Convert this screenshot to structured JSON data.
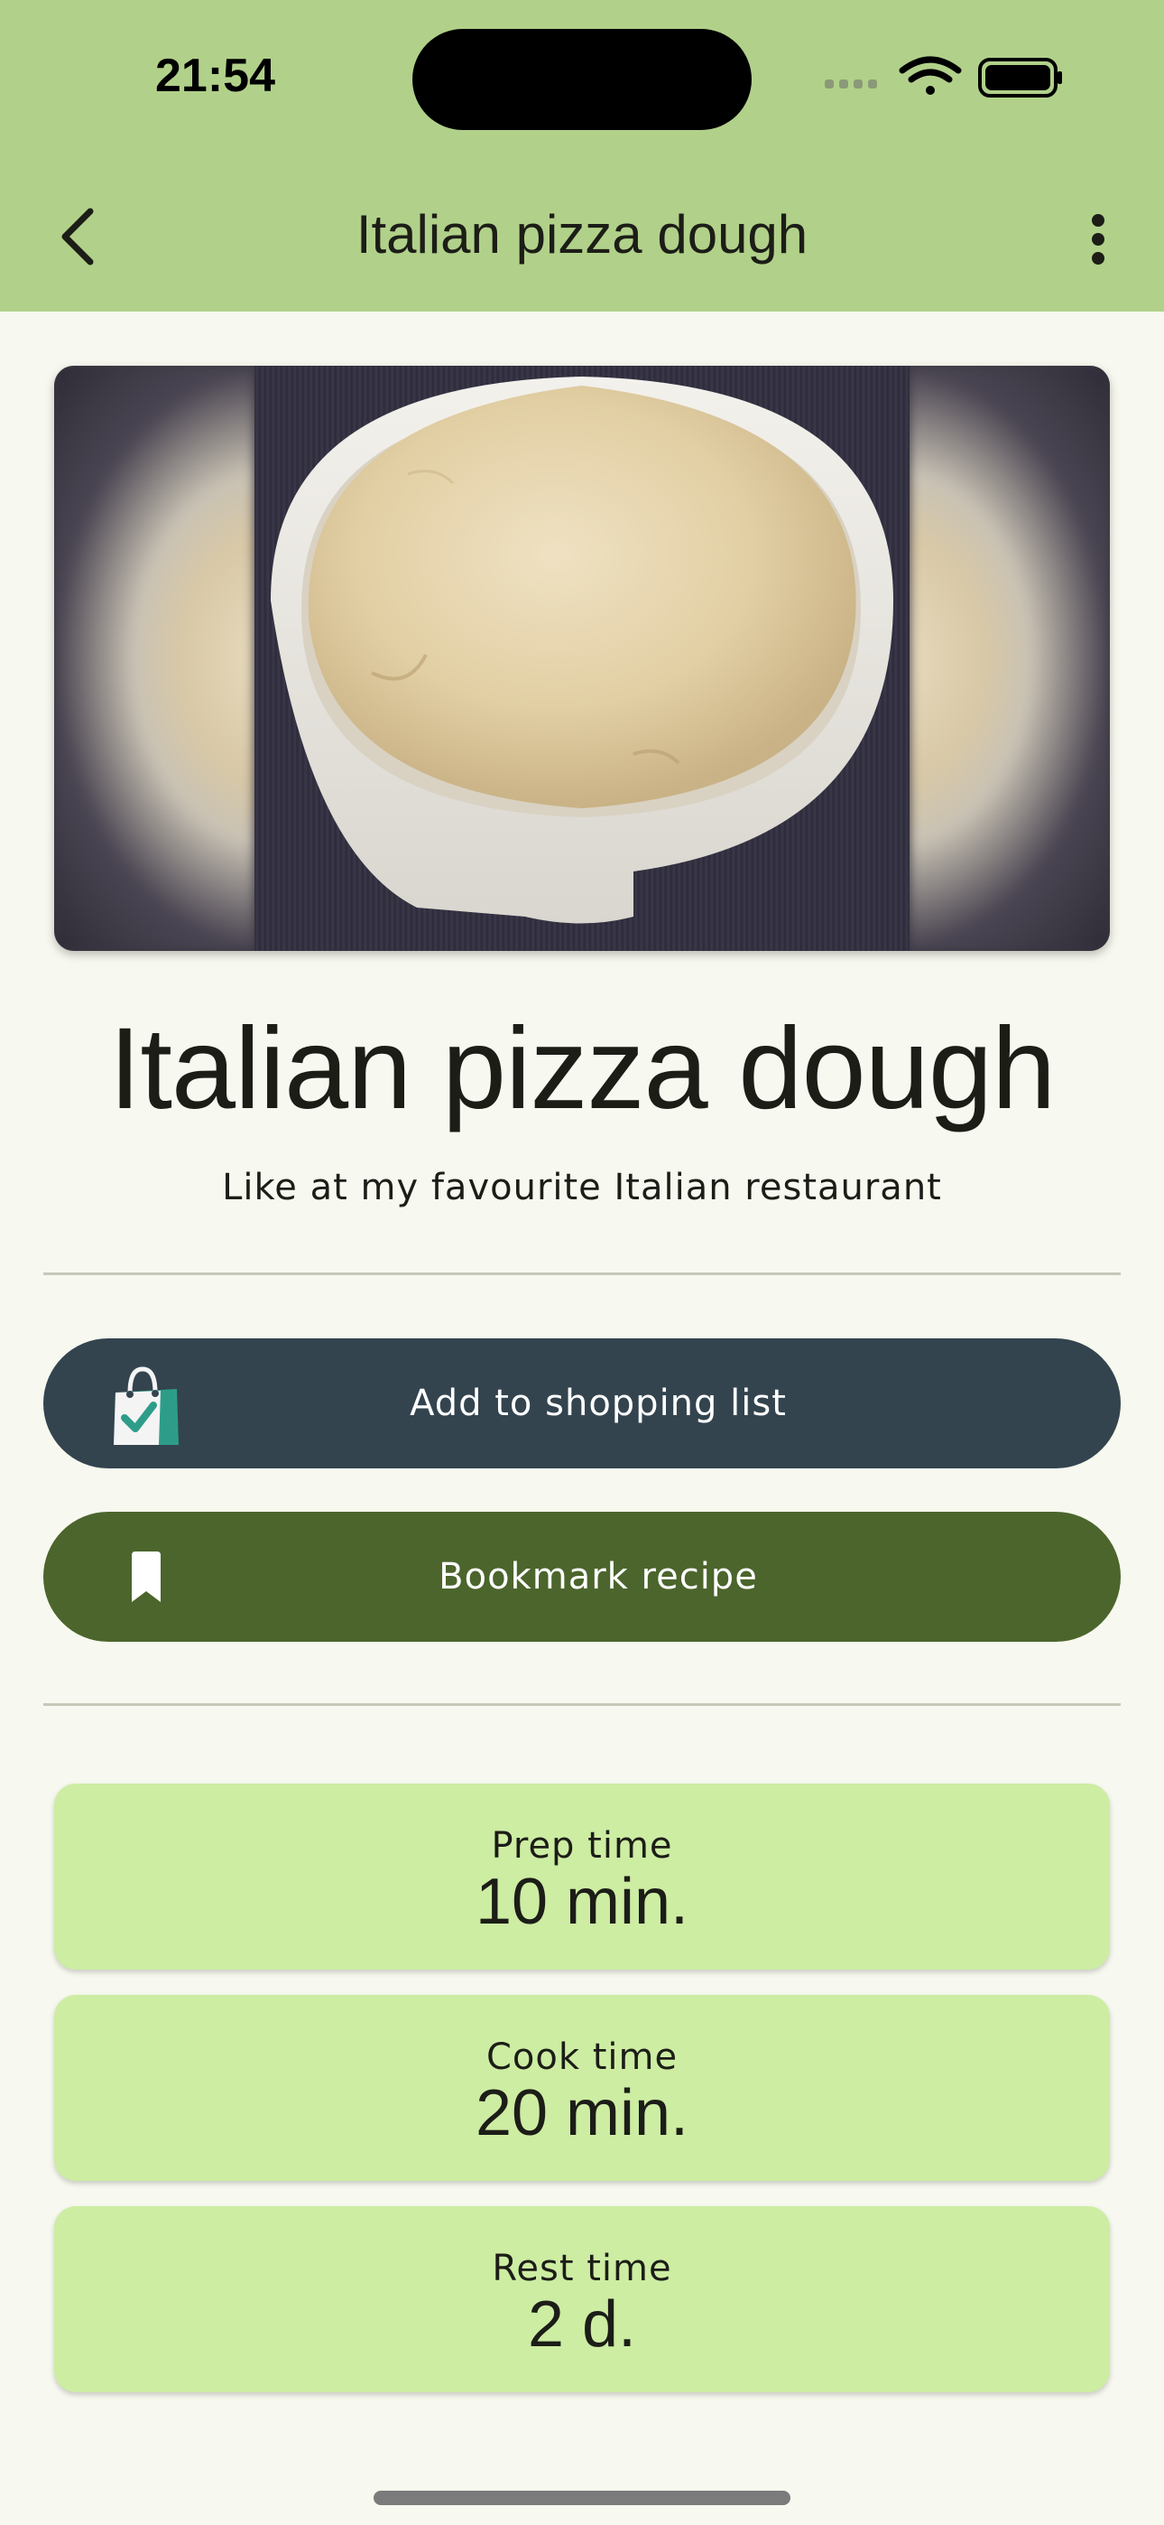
{
  "status_bar": {
    "time": "21:54"
  },
  "app_bar": {
    "title": "Italian pizza dough",
    "back_icon": "chevron-left-icon",
    "menu_icon": "more-vert-icon"
  },
  "recipe": {
    "image_alt": "Bowl of risen pizza dough",
    "title": "Italian pizza dough",
    "subtitle": "Like at my favourite Italian restaurant"
  },
  "actions": {
    "shopping_label": "Add to shopping list",
    "shopping_icon": "shopping-bag-check-icon",
    "bookmark_label": "Bookmark recipe",
    "bookmark_icon": "bookmark-icon"
  },
  "times": [
    {
      "label": "Prep time",
      "value": "10 min."
    },
    {
      "label": "Cook time",
      "value": "20 min."
    },
    {
      "label": "Rest time",
      "value": "2 d."
    }
  ],
  "colors": {
    "app_bar": "#b1d18a",
    "background": "#f7f8ef",
    "shopping_button": "#33444f",
    "bookmark_button": "#4b652c",
    "time_card": "#cdeda3"
  }
}
